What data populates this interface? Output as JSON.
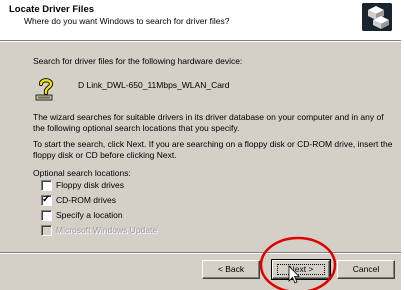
{
  "header": {
    "title": "Locate Driver Files",
    "subtitle": "Where do you want Windows to search for driver files?",
    "icon": "hardware-wizard-icon"
  },
  "body": {
    "intro": "Search for driver files for the following hardware device:",
    "device_name": "D Link_DWL-650_11Mbps_WLAN_Card",
    "device_icon": "unknown-device-question-icon",
    "para1": "The wizard searches for suitable drivers in its driver database on your computer and in any of the following optional search locations that you specify.",
    "para2": "To start the search, click Next. If you are searching on a floppy disk or CD-ROM drive, insert the floppy disk or CD before clicking Next.",
    "options_label": "Optional search locations:",
    "options": [
      {
        "label": "Floppy disk drives",
        "checked": false,
        "enabled": true
      },
      {
        "label": "CD-ROM drives",
        "checked": true,
        "enabled": true
      },
      {
        "label": "Specify a location",
        "checked": false,
        "enabled": true
      },
      {
        "label": "Microsoft Windows Update",
        "checked": false,
        "enabled": false
      }
    ]
  },
  "footer": {
    "back_label": "< Back",
    "next_label": "Next >",
    "cancel_label": "Cancel"
  },
  "colors": {
    "dialog_bg": "#d4d0c8",
    "header_bg": "#ffffff",
    "annotation": "#e00000"
  }
}
